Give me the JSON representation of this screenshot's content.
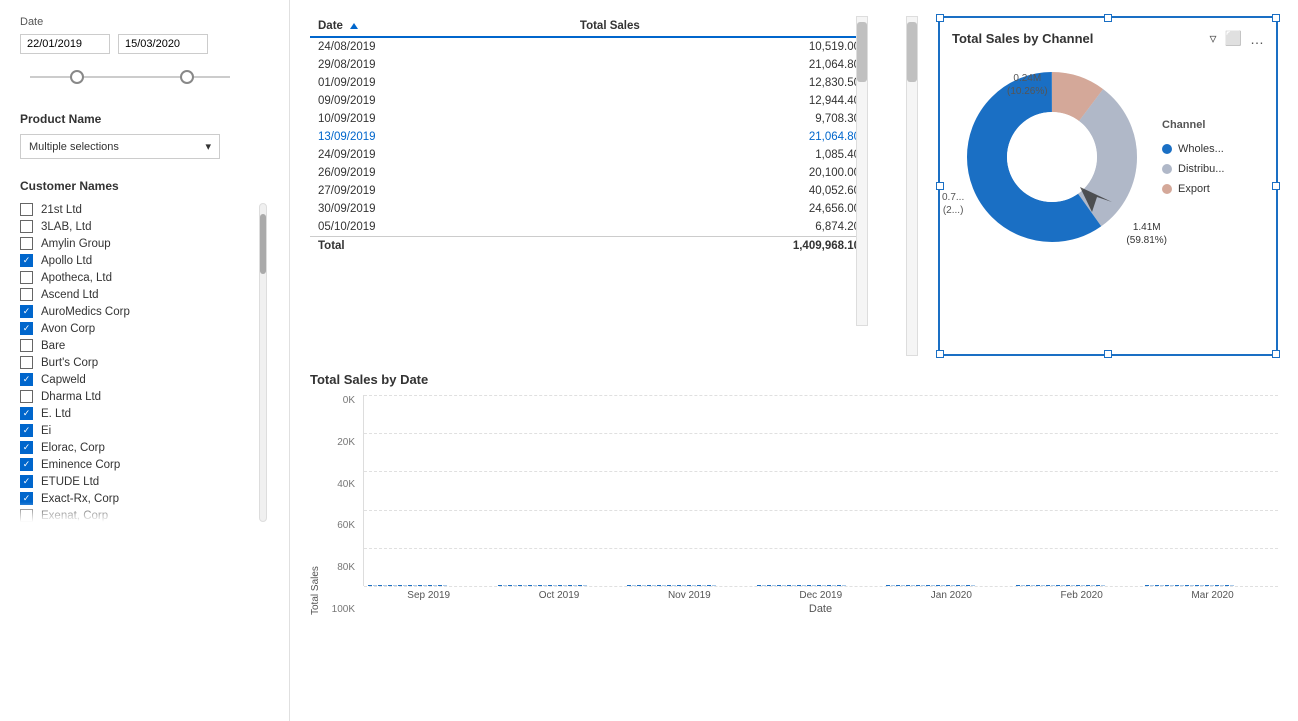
{
  "filters": {
    "date_label": "Date",
    "date_start": "22/01/2019",
    "date_end": "15/03/2020",
    "product_name_label": "Product Name",
    "product_name_value": "Multiple selections",
    "customer_names_label": "Customer Names",
    "customers": [
      {
        "name": "21st Ltd",
        "checked": false
      },
      {
        "name": "3LAB, Ltd",
        "checked": false
      },
      {
        "name": "Amylin Group",
        "checked": false
      },
      {
        "name": "Apollo Ltd",
        "checked": true
      },
      {
        "name": "Apotheca, Ltd",
        "checked": false
      },
      {
        "name": "Ascend Ltd",
        "checked": false
      },
      {
        "name": "AuroMedics Corp",
        "checked": true
      },
      {
        "name": "Avon Corp",
        "checked": true
      },
      {
        "name": "Bare",
        "checked": false
      },
      {
        "name": "Burt's Corp",
        "checked": false
      },
      {
        "name": "Capweld",
        "checked": true
      },
      {
        "name": "Dharma Ltd",
        "checked": false
      },
      {
        "name": "E. Ltd",
        "checked": true
      },
      {
        "name": "Ei",
        "checked": true
      },
      {
        "name": "Elorac, Corp",
        "checked": true
      },
      {
        "name": "Eminence Corp",
        "checked": true
      },
      {
        "name": "ETUDE Ltd",
        "checked": true
      },
      {
        "name": "Exact-Rx, Corp",
        "checked": true
      },
      {
        "name": "Exenat, Corp",
        "checked": false
      }
    ]
  },
  "table": {
    "col1": "Date",
    "col2": "Total Sales",
    "rows": [
      {
        "date": "24/08/2019",
        "sales": "10,519.00",
        "highlighted": false
      },
      {
        "date": "29/08/2019",
        "sales": "21,064.80",
        "highlighted": false
      },
      {
        "date": "01/09/2019",
        "sales": "12,830.50",
        "highlighted": false
      },
      {
        "date": "09/09/2019",
        "sales": "12,944.40",
        "highlighted": false
      },
      {
        "date": "10/09/2019",
        "sales": "9,708.30",
        "highlighted": false
      },
      {
        "date": "13/09/2019",
        "sales": "21,064.80",
        "highlighted": true
      },
      {
        "date": "24/09/2019",
        "sales": "1,085.40",
        "highlighted": false
      },
      {
        "date": "26/09/2019",
        "sales": "20,100.00",
        "highlighted": false
      },
      {
        "date": "27/09/2019",
        "sales": "40,052.60",
        "highlighted": false
      },
      {
        "date": "30/09/2019",
        "sales": "24,656.00",
        "highlighted": false
      },
      {
        "date": "05/10/2019",
        "sales": "6,874.20",
        "highlighted": false
      }
    ],
    "total_label": "Total",
    "total_value": "1,409,968.10"
  },
  "donut_chart": {
    "title": "Total Sales by Channel",
    "segments": [
      {
        "label": "Wholes...",
        "color": "#1a6fc4",
        "percent": 59.81,
        "value_label": "1.41M",
        "percent_label": "(59.81%)",
        "position": "bottom-right"
      },
      {
        "label": "Distribu...",
        "color": "#b0b8c8",
        "percent": 29.93,
        "value_label": "0.7...",
        "percent_label": "(2...)",
        "position": "left"
      },
      {
        "label": "Export",
        "color": "#d4a899",
        "percent": 10.26,
        "value_label": "0.24M",
        "percent_label": "(10.26%)",
        "position": "top"
      }
    ],
    "legend_title": "Channel"
  },
  "bar_chart": {
    "title": "Total Sales by Date",
    "y_axis_title": "Total Sales",
    "x_axis_title": "Date",
    "y_labels": [
      "100K",
      "80K",
      "60K",
      "40K",
      "20K",
      "0K"
    ],
    "x_labels": [
      "Sep 2019",
      "Oct 2019",
      "Nov 2019",
      "Dec 2019",
      "Jan 2020",
      "Feb 2020",
      "Mar 2020"
    ],
    "colors": {
      "dark": "#1a6fc4",
      "light": "#a8c8e8"
    }
  }
}
